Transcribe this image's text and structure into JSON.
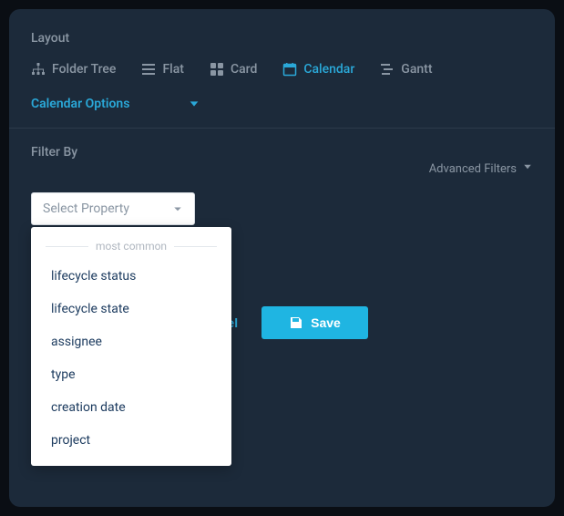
{
  "layout": {
    "title": "Layout",
    "tabs": [
      {
        "label": "Folder Tree"
      },
      {
        "label": "Flat"
      },
      {
        "label": "Card"
      },
      {
        "label": "Calendar"
      },
      {
        "label": "Gantt"
      }
    ],
    "active_tab": "Calendar"
  },
  "calendar_options": {
    "label": "Calendar Options"
  },
  "filter": {
    "title": "Filter By",
    "advanced_label": "Advanced Filters",
    "select_placeholder": "Select Property",
    "group_label": "most common",
    "items": [
      "lifecycle status",
      "lifecycle state",
      "assignee",
      "type",
      "creation date",
      "project"
    ]
  },
  "actions": {
    "cancel": "Cancel",
    "save": "Save"
  },
  "colors": {
    "accent": "#2aa8d8",
    "save_bg": "#1fb5e2"
  }
}
